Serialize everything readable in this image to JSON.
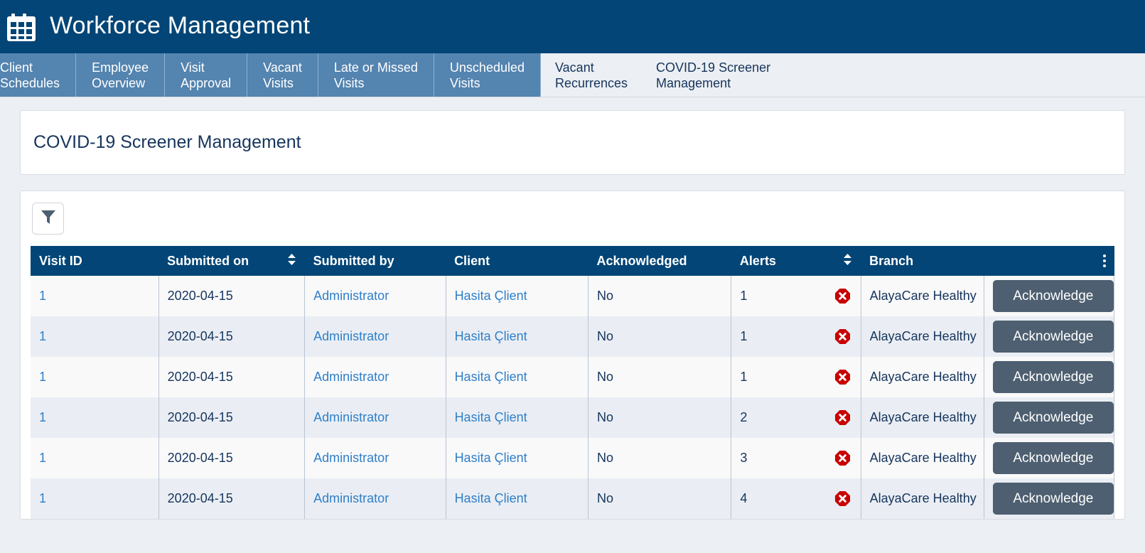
{
  "header": {
    "icon": "calendar-icon",
    "title": "Workforce Management",
    "bg_color": "#024576"
  },
  "tabs": [
    {
      "line1": "Client",
      "line2": "Schedules",
      "active": true,
      "style": "blue"
    },
    {
      "line1": "Employee",
      "line2": "Overview",
      "active": true,
      "style": "blue"
    },
    {
      "line1": "Visit",
      "line2": "Approval",
      "active": true,
      "style": "blue"
    },
    {
      "line1": "Vacant",
      "line2": "Visits",
      "active": true,
      "style": "blue"
    },
    {
      "line1": "Late or Missed",
      "line2": "Visits",
      "active": true,
      "style": "blue"
    },
    {
      "line1": "Unscheduled",
      "line2": "Visits",
      "active": true,
      "style": "blue"
    },
    {
      "line1": "Vacant",
      "line2": "Recurrences",
      "active": false,
      "style": "plain"
    },
    {
      "line1": "COVID-19 Screener",
      "line2": "Management",
      "active": false,
      "style": "plain"
    }
  ],
  "page": {
    "title": "COVID-19 Screener Management"
  },
  "toolbar": {
    "filter_icon": "filter-icon",
    "filter_label": "Filter"
  },
  "table": {
    "menu_icon": "kebab-menu-icon",
    "columns": [
      {
        "label": "Visit ID",
        "sortable": false
      },
      {
        "label": "Submitted on",
        "sortable": true
      },
      {
        "label": "Submitted by",
        "sortable": false
      },
      {
        "label": "Client",
        "sortable": false
      },
      {
        "label": "Acknowledged",
        "sortable": false
      },
      {
        "label": "Alerts",
        "sortable": true
      },
      {
        "label": "Branch",
        "sortable": false
      }
    ],
    "action_label": "Acknowledge",
    "alert_icon": "error-octagon-icon",
    "rows": [
      {
        "visit_id": "1",
        "submitted_on": "2020-04-15",
        "submitted_by": "Administrator",
        "client": "Hasita Çlient",
        "acknowledged": "No",
        "alerts": "1",
        "branch": "AlayaCare Healthy"
      },
      {
        "visit_id": "1",
        "submitted_on": "2020-04-15",
        "submitted_by": "Administrator",
        "client": "Hasita Çlient",
        "acknowledged": "No",
        "alerts": "1",
        "branch": "AlayaCare Healthy"
      },
      {
        "visit_id": "1",
        "submitted_on": "2020-04-15",
        "submitted_by": "Administrator",
        "client": "Hasita Çlient",
        "acknowledged": "No",
        "alerts": "1",
        "branch": "AlayaCare Healthy"
      },
      {
        "visit_id": "1",
        "submitted_on": "2020-04-15",
        "submitted_by": "Administrator",
        "client": "Hasita Çlient",
        "acknowledged": "No",
        "alerts": "2",
        "branch": "AlayaCare Healthy"
      },
      {
        "visit_id": "1",
        "submitted_on": "2020-04-15",
        "submitted_by": "Administrator",
        "client": "Hasita Çlient",
        "acknowledged": "No",
        "alerts": "3",
        "branch": "AlayaCare Healthy"
      },
      {
        "visit_id": "1",
        "submitted_on": "2020-04-15",
        "submitted_by": "Administrator",
        "client": "Hasita Çlient",
        "acknowledged": "No",
        "alerts": "4",
        "branch": "AlayaCare Healthy"
      }
    ]
  },
  "colors": {
    "brand_dark": "#024576",
    "tab_blue": "#5484b0",
    "link": "#2f7fc8",
    "alert_red": "#c80000",
    "action_gray": "#4d5f70"
  }
}
